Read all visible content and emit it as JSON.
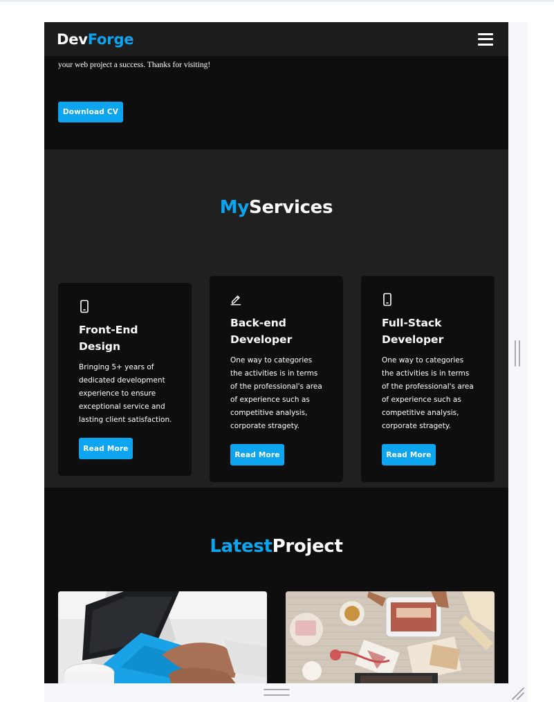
{
  "nav": {
    "brand_main": "Dev",
    "brand_accent": "Forge",
    "menu_icon": "hamburger-icon"
  },
  "hero": {
    "text": "your web project a success. Thanks for visiting!",
    "download_button": "Download CV"
  },
  "services": {
    "title_accent": "My",
    "title_main": "Services",
    "cards": [
      {
        "icon": "mobile-icon",
        "title": "Front-End Design",
        "description": "Bringing 5+ years of dedicated development experience to ensure exceptional service and lasting client satisfaction.",
        "button": "Read More"
      },
      {
        "icon": "pencil-icon",
        "title": "Back-end Developer",
        "description": "One way to categories the activities is in terms of the professional's area of experience such as competitive analysis, corporate stragety.",
        "button": "Read More"
      },
      {
        "icon": "mobile-icon",
        "title": "Full-Stack Developer",
        "description": "One way to categories the activities is in terms of the professional's area of experience such as competitive analysis, corporate stragety.",
        "button": "Read More"
      }
    ]
  },
  "projects": {
    "title_accent": "Latest",
    "title_main": "Project",
    "images": [
      "laptop-typing-photo",
      "desk-flatlay-photo"
    ]
  },
  "colors": {
    "accent": "#0ea5f0",
    "background": "#0e0e0e",
    "section_alt": "#202020",
    "nav": "#1d1d1d"
  }
}
